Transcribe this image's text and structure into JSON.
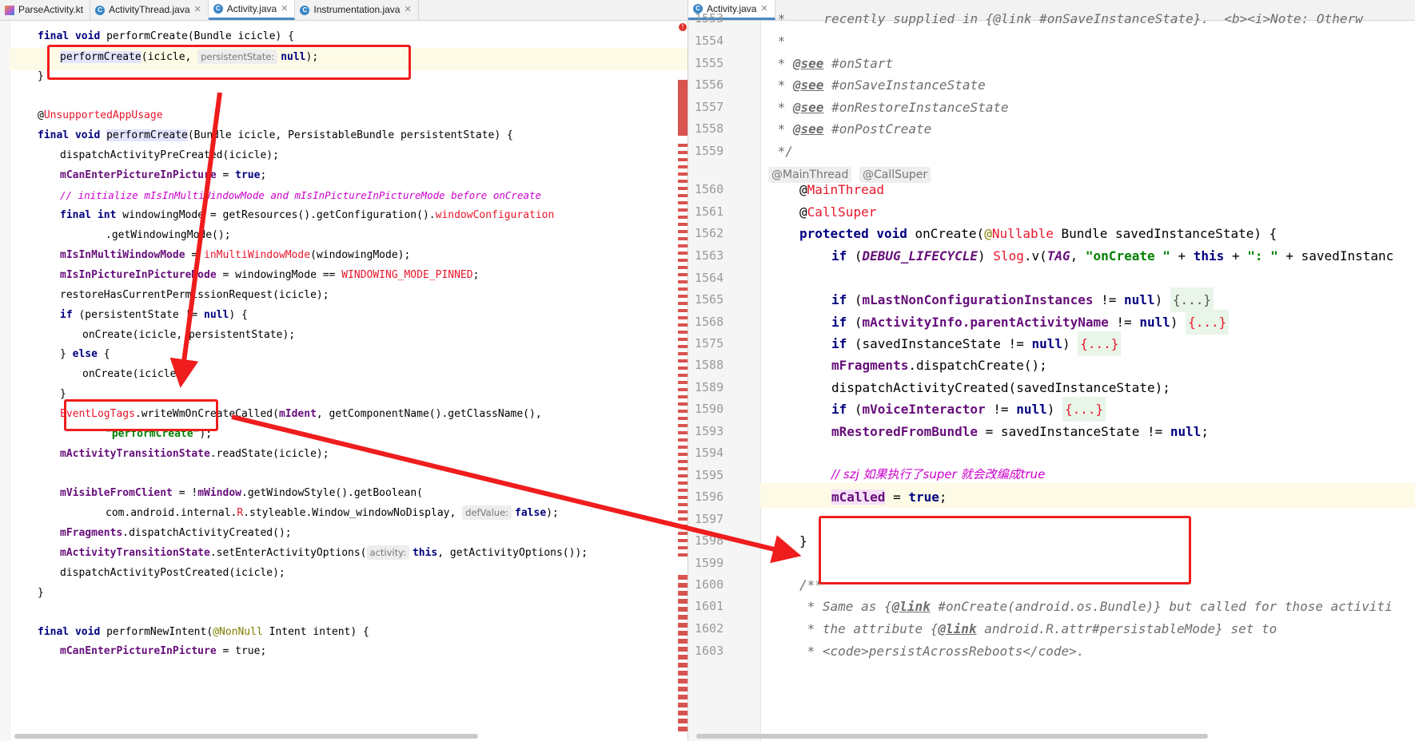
{
  "left_tabs": [
    {
      "label": "ParseActivity.kt",
      "icon": "kotlin-file-icon"
    },
    {
      "label": "ActivityThread.java",
      "icon": "java-class-icon"
    },
    {
      "label": "Activity.java",
      "icon": "java-class-icon",
      "active": true
    },
    {
      "label": "Instrumentation.java",
      "icon": "java-class-icon"
    }
  ],
  "right_tabs": [
    {
      "label": "Activity.java",
      "icon": "java-class-icon",
      "active": true
    }
  ],
  "left_code": {
    "l1_kw": "final void",
    "l1_rest": " performCreate(Bundle icicle) {",
    "l2_call": "performCreate",
    "l2_args": "(icicle, ",
    "l2_param": "persistentState:",
    "l2_null": "null",
    "l2_end": ");",
    "l3": "}",
    "l4_at": "@",
    "l4_ann": "UnsupportedAppUsage",
    "l5_kw": "final void",
    "l5_name": "performCreate",
    "l5_rest": "(Bundle icicle, PersistableBundle persistentState) {",
    "l6": "dispatchActivityPreCreated(icicle);",
    "l7_field": "mCanEnterPictureInPicture",
    "l7_eq": " = ",
    "l7_true": "true",
    "l7_end": ";",
    "l8_comment": "// initialize mIsInMultiWindowMode and mIsInPictureInPictureMode before onCreate",
    "l9_kw": "final int",
    "l9_rest": " windowingMode = getResources().getConfiguration().",
    "l9_red": "windowConfiguration",
    "l10": ".getWindowingMode();",
    "l11_field": "mIsInMultiWindowMode",
    "l11_eq": " = ",
    "l11_red": "inMultiWindowMode",
    "l11_end": "(windowingMode);",
    "l12_field": "mIsInPictureInPictureMode",
    "l12_mid": " = windowingMode == ",
    "l12_red": "WINDOWING_MODE_PINNED",
    "l12_end": ";",
    "l13": "restoreHasCurrentPermissionRequest(icicle);",
    "l14_kw": "if",
    "l14_mid": " (persistentState != ",
    "l14_null": "null",
    "l14_end": ") {",
    "l15": "onCreate(icicle, persistentState);",
    "l16_a": "} ",
    "l16_kw": "else",
    "l16_b": " {",
    "l17": "onCreate(icicle);",
    "l18": "}",
    "l19_red": "EventLogTags",
    "l19_mid": ".writeWmOnCreateCalled(",
    "l19_field": "mIdent",
    "l19_end": ", getComponentName().getClassName(),",
    "l20_str": "\"performCreate\"",
    "l20_end": ");",
    "l21_field": "mActivityTransitionState",
    "l21_end": ".readState(icicle);",
    "l22_field": "mVisibleFromClient",
    "l22_mid": " = !",
    "l22_field2": "mWindow",
    "l22_end": ".getWindowStyle().getBoolean(",
    "l23_a": "com.android.internal.",
    "l23_red": "R",
    "l23_b": ".styleable.Window_windowNoDisplay, ",
    "l23_param": "defValue:",
    "l23_false": "false",
    "l23_end": ");",
    "l24_field": "mFragments",
    "l24_end": ".dispatchActivityCreated();",
    "l25_field": "mActivityTransitionState",
    "l25_mid": ".setEnterActivityOptions(",
    "l25_param": "activity:",
    "l25_this": "this",
    "l25_end": ", getActivityOptions());",
    "l26": "dispatchActivityPostCreated(icicle);",
    "l27": "}",
    "l28_kw": "final void",
    "l28_mid": " performNewIntent(",
    "l28_ann": "@NonNull",
    "l28_end": " Intent intent) {",
    "l29_field": "mCanEnterPictureInPicture",
    "l29_end": " = true;"
  },
  "right_code": {
    "line_numbers": [
      "1553",
      "1554",
      "1555",
      "1556",
      "1557",
      "1558",
      "1559",
      "1560",
      "1561",
      "1562",
      "1563",
      "1564",
      "1565",
      "1568",
      "1575",
      "1588",
      "1589",
      "1590",
      "1593",
      "1594",
      "1595",
      "1596",
      "1597",
      "1598",
      "1599",
      "1600",
      "1601",
      "1602",
      "1603"
    ],
    "r0": " *     recently supplied in {@link #onSaveInstanceState}.  <b><i>Note: Otherw",
    "r1": " *",
    "r2_tag": "@see",
    "r2_rest": " #onStart",
    "r3_tag": "@see",
    "r3_rest": " #onSaveInstanceState",
    "r4_tag": "@see",
    "r4_rest": " #onRestoreInstanceState",
    "r5_tag": "@see",
    "r5_rest": " #onPostCreate",
    "r6": " */",
    "inlay_1": "@MainThread",
    "inlay_2": "@CallSuper",
    "r7_at": "@",
    "r7_red": "MainThread",
    "r8_at": "@",
    "r8_red": "CallSuper",
    "r9_kw": "protected void",
    "r9_mid": " onCreate(",
    "r9_ann": "@",
    "r9_red": "Nullable",
    "r9_end": " Bundle savedInstanceState) {",
    "r10_kw": "if",
    "r10_a": " (",
    "r10_const": "DEBUG_LIFECYCLE",
    "r10_b": ") ",
    "r10_red": "Slog",
    "r10_c": ".v(",
    "r10_tag": "TAG",
    "r10_d": ", ",
    "r10_str": "\"onCreate \"",
    "r10_e": " + ",
    "r10_this": "this",
    "r10_f": " + ",
    "r10_str2": "\": \"",
    "r10_g": " + savedInstanc",
    "r12_kw": "if",
    "r12_a": " (",
    "r12_field": "mLastNonConfigurationInstances",
    "r12_b": " != ",
    "r12_null": "null",
    "r12_c": ") ",
    "r12_fold": "{...}",
    "r13_kw": "if",
    "r13_a": " (",
    "r13_field": "mActivityInfo.parentActivityName",
    "r13_b": " != ",
    "r13_null": "null",
    "r13_c": ") ",
    "r13_fold": "{...}",
    "r14_kw": "if",
    "r14_a": " (savedInstanceState != ",
    "r14_null": "null",
    "r14_c": ") ",
    "r14_fold": "{...}",
    "r15_field": "mFragments",
    "r15_end": ".dispatchCreate();",
    "r16": "dispatchActivityCreated(savedInstanceState);",
    "r17_kw": "if",
    "r17_a": " (",
    "r17_field": "mVoiceInteractor",
    "r17_b": " != ",
    "r17_null": "null",
    "r17_c": ") ",
    "r17_fold": "{...}",
    "r18_field": "mRestoredFromBundle",
    "r18_mid": " = savedInstanceState != ",
    "r18_null": "null",
    "r18_end": ";",
    "r20_comment": "// szj 如果执行了super 就会改编成true",
    "r21_field": "mCalled",
    "r21_mid": " = ",
    "r21_true": "true",
    "r21_end": ";",
    "r23": "}",
    "r25": "/**",
    "r26_a": " * Same as {",
    "r26_tag": "@link",
    "r26_b": " #onCreate(android.os.Bundle)} but called for those activiti",
    "r27_a": " * the attribute {",
    "r27_tag": "@link",
    "r27_b": " android.R.attr#persistableMode} set to",
    "r28": " * <code>persistAcrossReboots</code>."
  },
  "colors": {
    "annotation_box": "#ef1d1d",
    "arrow": "#ef1d1d",
    "highlight_row": "#fdfbe6"
  }
}
